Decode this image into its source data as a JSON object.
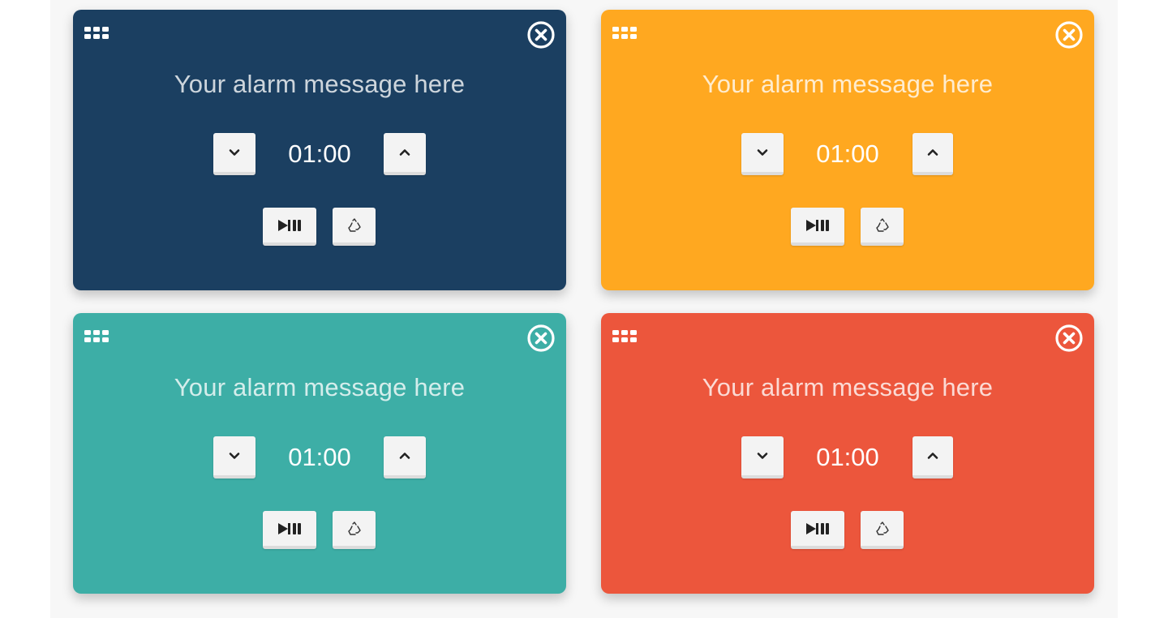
{
  "timers": [
    {
      "message": "Your alarm message here",
      "time": "01:00",
      "color": "#1b3f61"
    },
    {
      "message": "Your alarm message here",
      "time": "01:00",
      "color": "#ffa820"
    },
    {
      "message": "Your alarm message here",
      "time": "01:00",
      "color": "#3daea6"
    },
    {
      "message": "Your alarm message here",
      "time": "01:00",
      "color": "#ec563c"
    }
  ],
  "icons": {
    "drag": "grid-icon",
    "close": "close-circle-icon",
    "decrease": "chevron-down-icon",
    "increase": "chevron-up-icon",
    "play_pause": "play-pause-icon",
    "reset": "recycle-icon"
  }
}
